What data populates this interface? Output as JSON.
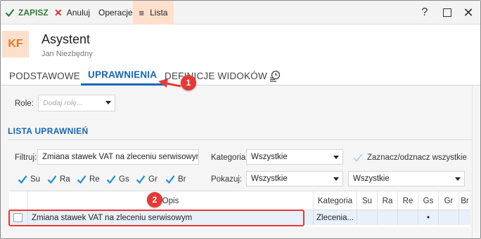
{
  "toolbar": {
    "save_label": "ZAPISZ",
    "cancel_label": "Anuluj",
    "operations_label": "Operacje",
    "list_label": "Lista",
    "help_glyph": "?",
    "close_glyph": "✕"
  },
  "header": {
    "avatar_initials": "KF",
    "title": "Asystent",
    "subtitle": "Jan Niezbędny"
  },
  "tabs": [
    {
      "label": "PODSTAWOWE",
      "active": false
    },
    {
      "label": "UPRAWNIENIA",
      "active": true
    },
    {
      "label": "DEFINICJE WIDOKÓW",
      "active": false
    },
    {
      "icon": "history-icon"
    }
  ],
  "roles": {
    "label": "Role:",
    "placeholder": "Dodaj rolę..."
  },
  "section": {
    "title": "LISTA UPRAWNIEŃ"
  },
  "filters": {
    "filter_label": "Filtruj:",
    "filter_value": "Zmiana stawek VAT na zleceniu serwisowym",
    "category_label": "Kategoria:",
    "category_value": "Wszystkie",
    "toggle_all_label": "Zaznacz/odznacz wszystkie",
    "show_label": "Pokazuj:",
    "show_value": "Wszystkie",
    "second_value": "Wszystkie"
  },
  "checks": [
    {
      "label": "Su",
      "checked": true
    },
    {
      "label": "Ra",
      "checked": true
    },
    {
      "label": "Re",
      "checked": true
    },
    {
      "label": "Gs",
      "checked": true
    },
    {
      "label": "Gr",
      "checked": true
    },
    {
      "label": "Br",
      "checked": true
    }
  ],
  "table": {
    "columns": [
      "Opis",
      "Kategoria",
      "Su",
      "Ra",
      "Re",
      "Gs",
      "Gr",
      "Br"
    ],
    "rows": [
      {
        "opis": "Zmiana stawek VAT na zleceniu serwisowym",
        "kategoria": "Zlecenia...",
        "su": "",
        "ra": "",
        "re": "",
        "gs": "•",
        "gr": "",
        "br": ""
      }
    ]
  },
  "annotations": {
    "badge1": "1",
    "badge2": "2"
  },
  "colors": {
    "accent": "#1366b8",
    "save_green": "#2e7d32",
    "cancel_red": "#d32f2f",
    "annotation_red": "#e53935",
    "list_tab_bg": "#fde0cc",
    "avatar_fg": "#e07a2f",
    "check_blue": "#1a8cd8",
    "selected_row": "#e8f0f9"
  }
}
